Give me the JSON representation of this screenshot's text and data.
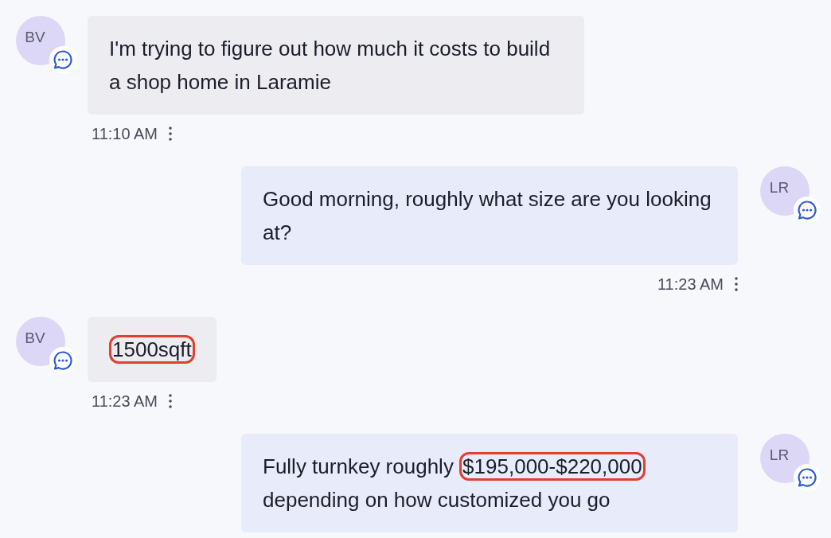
{
  "messages": [
    {
      "kind": "incoming",
      "avatar": "BV",
      "parts": [
        {
          "text": "I'm trying to figure out how much it costs to build a shop home in Laramie",
          "highlighted": false
        }
      ],
      "time": "11:10 AM"
    },
    {
      "kind": "outgoing",
      "avatar": "LR",
      "parts": [
        {
          "text": "Good morning, roughly what size are you looking at?",
          "highlighted": false
        }
      ],
      "time": "11:23 AM"
    },
    {
      "kind": "incoming",
      "avatar": "BV",
      "parts": [
        {
          "text": "1500sqft",
          "highlighted": true
        }
      ],
      "time": "11:23 AM"
    },
    {
      "kind": "outgoing",
      "avatar": "LR",
      "parts": [
        {
          "text": "Fully turnkey roughly ",
          "highlighted": false
        },
        {
          "text": "$195,000-$220,000",
          "highlighted": true
        },
        {
          "text": " depending on how customized you go",
          "highlighted": false
        }
      ]
    }
  ]
}
